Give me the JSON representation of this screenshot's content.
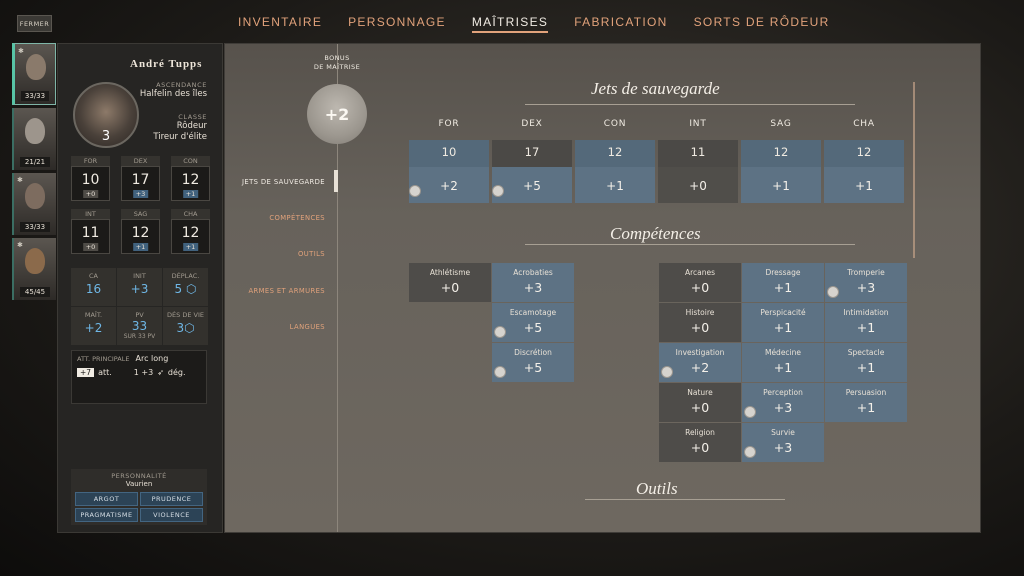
{
  "close_label": "FERMER",
  "tabs": [
    {
      "label": "INVENTAIRE",
      "active": false
    },
    {
      "label": "PERSONNAGE",
      "active": false
    },
    {
      "label": "MAÎTRISES",
      "active": true
    },
    {
      "label": "FABRICATION",
      "active": false
    },
    {
      "label": "SORTS DE RÔDEUR",
      "active": false
    }
  ],
  "party": [
    {
      "hp": "33/33",
      "active": true
    },
    {
      "hp": "21/21",
      "active": false
    },
    {
      "hp": "33/33",
      "active": false
    },
    {
      "hp": "45/45",
      "active": false
    }
  ],
  "character": {
    "name": "André Tupps",
    "level": "3",
    "ancestry_label": "ASCENDANCE",
    "ancestry": "Halfelin des îles",
    "class_label": "CLASSE",
    "class": "Rôdeur",
    "subclass": "Tireur d'élite",
    "abilities": [
      {
        "label": "FOR",
        "score": "10",
        "mod": "+0",
        "pos": false
      },
      {
        "label": "DEX",
        "score": "17",
        "mod": "+3",
        "pos": true
      },
      {
        "label": "CON",
        "score": "12",
        "mod": "+1",
        "pos": true
      },
      {
        "label": "INT",
        "score": "11",
        "mod": "+0",
        "pos": false
      },
      {
        "label": "SAG",
        "score": "12",
        "mod": "+1",
        "pos": true
      },
      {
        "label": "CHA",
        "score": "12",
        "mod": "+1",
        "pos": true
      }
    ],
    "combat": [
      {
        "label": "CA",
        "value": "16",
        "sub": ""
      },
      {
        "label": "INIT",
        "value": "+3",
        "sub": ""
      },
      {
        "label": "DÉPLAC.",
        "value": "5",
        "sub": ""
      },
      {
        "label": "MAÎT.",
        "value": "+2",
        "sub": ""
      },
      {
        "label": "PV",
        "value": "33",
        "sub": "SUR 33 PV"
      },
      {
        "label": "DÉS DE VIE",
        "value": "3",
        "sub": ""
      }
    ],
    "attack": {
      "label": "ATT. PRINCIPALE",
      "weapon": "Arc long",
      "bonus": "+7",
      "att": "att.",
      "damage": "1 +3",
      "deg": "dég."
    },
    "personality": {
      "label": "PERSONNALITÉ",
      "value": "Vaurien",
      "tags": [
        "ARGOT",
        "PRUDENCE",
        "PRAGMATISME",
        "VIOLENCE"
      ]
    }
  },
  "subnav": [
    {
      "label": "JETS DE SAUVEGARDE",
      "active": true
    },
    {
      "label": "COMPÉTENCES",
      "active": false
    },
    {
      "label": "OUTILS",
      "active": false
    },
    {
      "label": "ARMES ET ARMURES",
      "active": false
    },
    {
      "label": "LANGUES",
      "active": false
    }
  ],
  "bonus": {
    "label_line1": "BONUS",
    "label_line2": "DE MAÎTRISE",
    "value": "+2"
  },
  "saves_title": "Jets de sauvegarde",
  "saves": [
    {
      "ability": "FOR",
      "score": "10",
      "mod": "+2",
      "prof": true
    },
    {
      "ability": "DEX",
      "score": "17",
      "mod": "+5",
      "prof": true
    },
    {
      "ability": "CON",
      "score": "12",
      "mod": "+1",
      "prof": false
    },
    {
      "ability": "INT",
      "score": "11",
      "mod": "+0",
      "prof": false
    },
    {
      "ability": "SAG",
      "score": "12",
      "mod": "+1",
      "prof": false
    },
    {
      "ability": "CHA",
      "score": "12",
      "mod": "+1",
      "prof": false
    }
  ],
  "skills_title": "Compétences",
  "skills": {
    "for": [
      {
        "name": "Athlétisme",
        "value": "+0",
        "prof": false
      }
    ],
    "dex": [
      {
        "name": "Acrobaties",
        "value": "+3",
        "prof": false
      },
      {
        "name": "Escamotage",
        "value": "+5",
        "prof": true
      },
      {
        "name": "Discrétion",
        "value": "+5",
        "prof": true
      }
    ],
    "int": [
      {
        "name": "Arcanes",
        "value": "+0",
        "prof": false
      },
      {
        "name": "Histoire",
        "value": "+0",
        "prof": false
      },
      {
        "name": "Investigation",
        "value": "+2",
        "prof": true
      },
      {
        "name": "Nature",
        "value": "+0",
        "prof": false
      },
      {
        "name": "Religion",
        "value": "+0",
        "prof": false
      }
    ],
    "sag": [
      {
        "name": "Dressage",
        "value": "+1",
        "prof": false
      },
      {
        "name": "Perspicacité",
        "value": "+1",
        "prof": false
      },
      {
        "name": "Médecine",
        "value": "+1",
        "prof": false
      },
      {
        "name": "Perception",
        "value": "+3",
        "prof": true
      },
      {
        "name": "Survie",
        "value": "+3",
        "prof": true
      }
    ],
    "cha": [
      {
        "name": "Tromperie",
        "value": "+3",
        "prof": true
      },
      {
        "name": "Intimidation",
        "value": "+1",
        "prof": false
      },
      {
        "name": "Spectacle",
        "value": "+1",
        "prof": false
      },
      {
        "name": "Persuasion",
        "value": "+1",
        "prof": false
      }
    ]
  },
  "tools_title": "Outils",
  "colors": {
    "accent": "#e1a27b",
    "proficient": "#5d7284",
    "mod_positive": "#6fb7e6"
  }
}
